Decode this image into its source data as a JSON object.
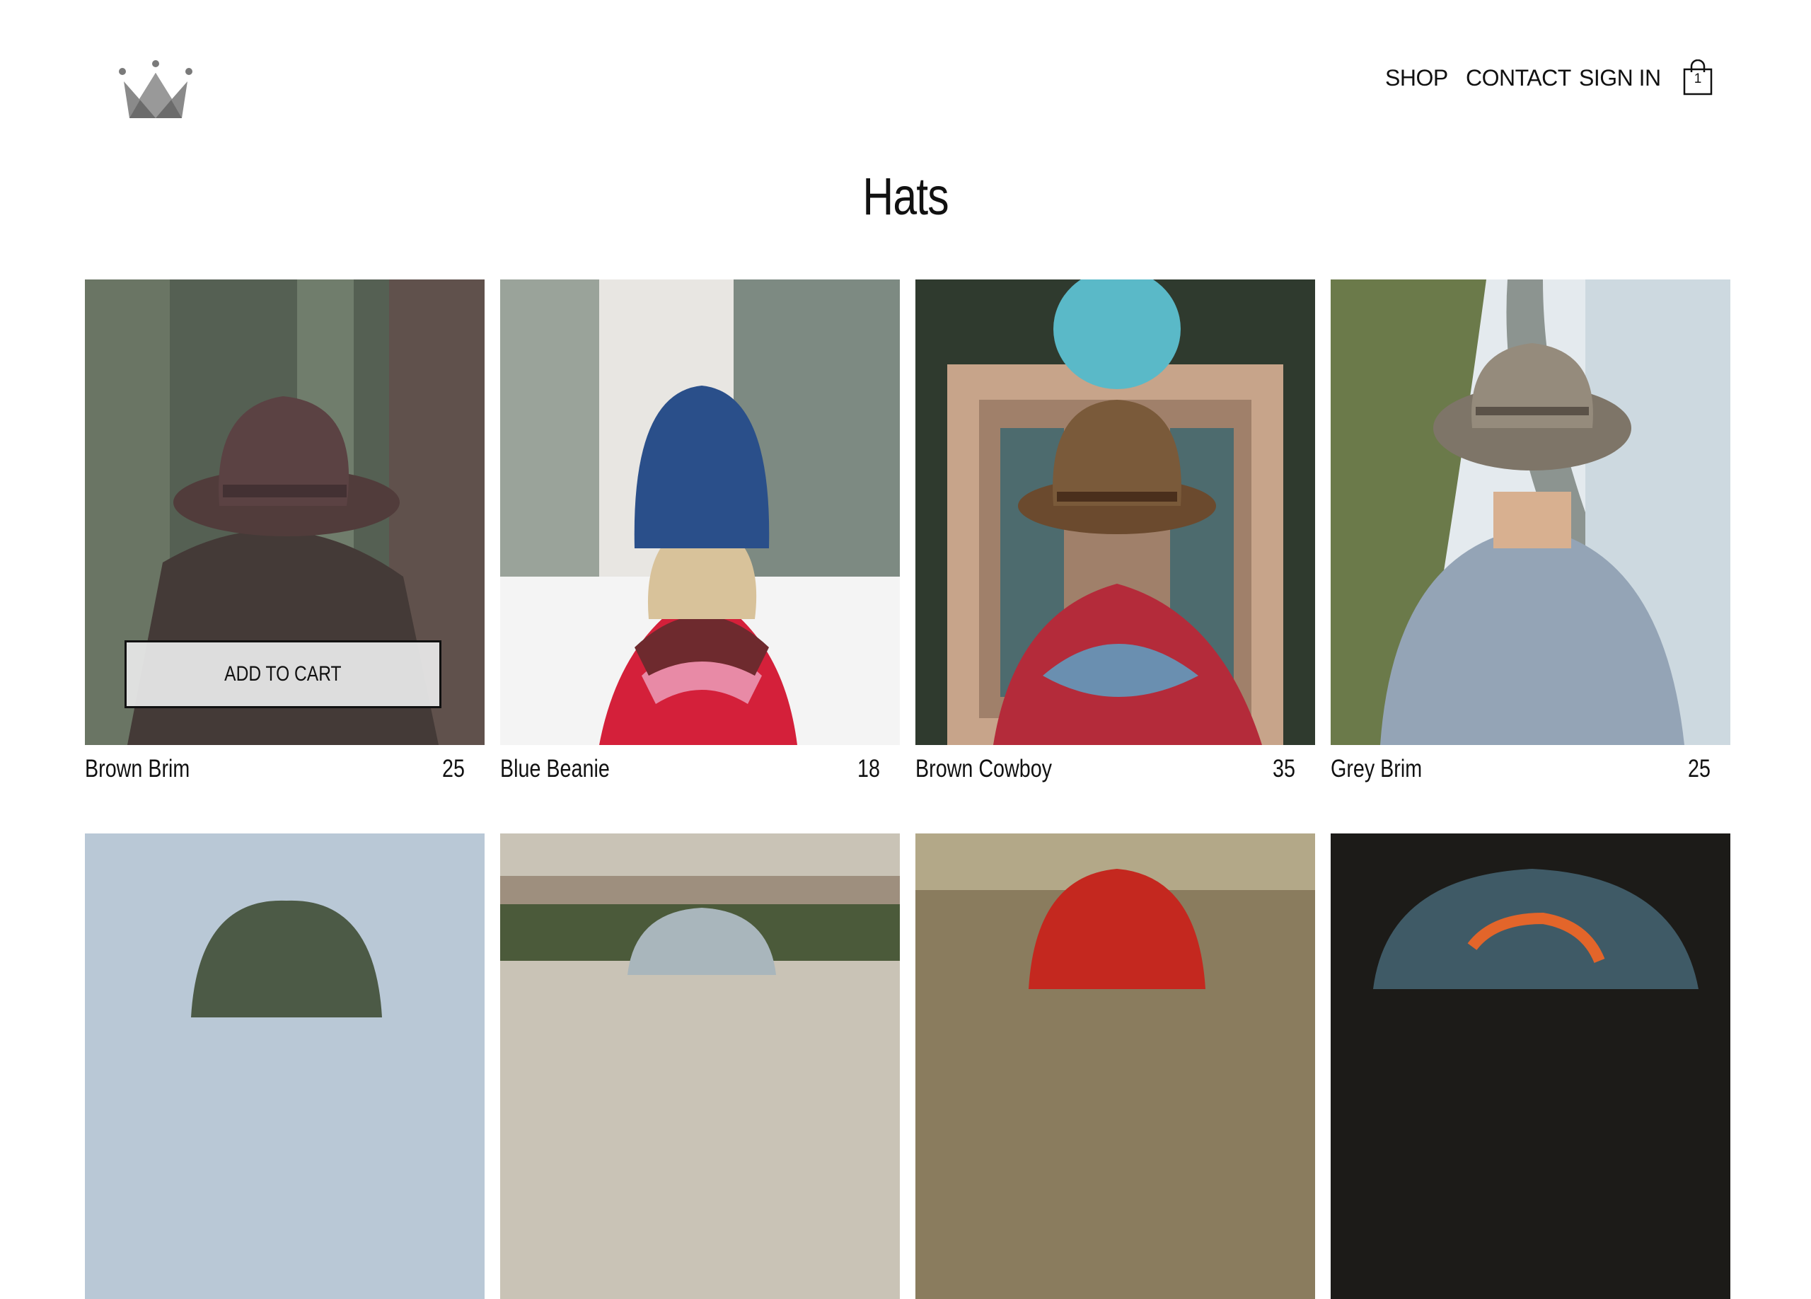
{
  "nav": {
    "shop": "SHOP",
    "contact": "CONTACT",
    "sign_in": "SIGN IN",
    "cart_count": "1"
  },
  "page": {
    "title": "Hats"
  },
  "products": [
    {
      "name": "Brown Brim",
      "price": "25",
      "button": "ADD TO CART"
    },
    {
      "name": "Blue Beanie",
      "price": "18"
    },
    {
      "name": "Brown Cowboy",
      "price": "35"
    },
    {
      "name": "Grey Brim",
      "price": "25"
    },
    {
      "name": "",
      "price": ""
    },
    {
      "name": "",
      "price": ""
    },
    {
      "name": "",
      "price": ""
    },
    {
      "name": "",
      "price": ""
    }
  ],
  "icons": {
    "logo": "crown-logo-icon",
    "cart": "shopping-bag-icon"
  },
  "colors": {
    "background": "#ffffff",
    "text": "#111111",
    "logo": "#808080",
    "button_bg": "#e6e6e6"
  }
}
